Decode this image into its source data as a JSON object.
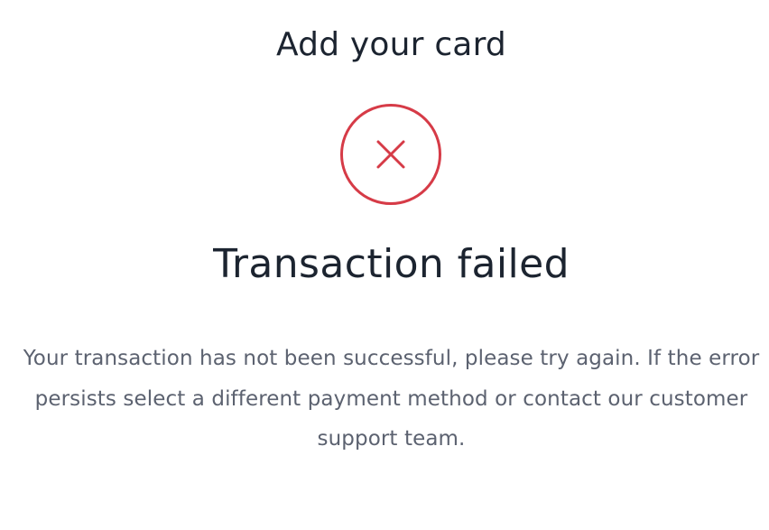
{
  "header": {
    "title": "Add your card"
  },
  "status": {
    "icon": "error-x-icon",
    "icon_color": "#d63b47",
    "title": "Transaction failed",
    "message": "Your transaction has not been successful, please try again. If the error persists select a different payment method or contact our customer support team."
  },
  "colors": {
    "heading": "#1c2430",
    "body_text": "#5c6270",
    "error": "#d63b47",
    "background": "#ffffff"
  }
}
